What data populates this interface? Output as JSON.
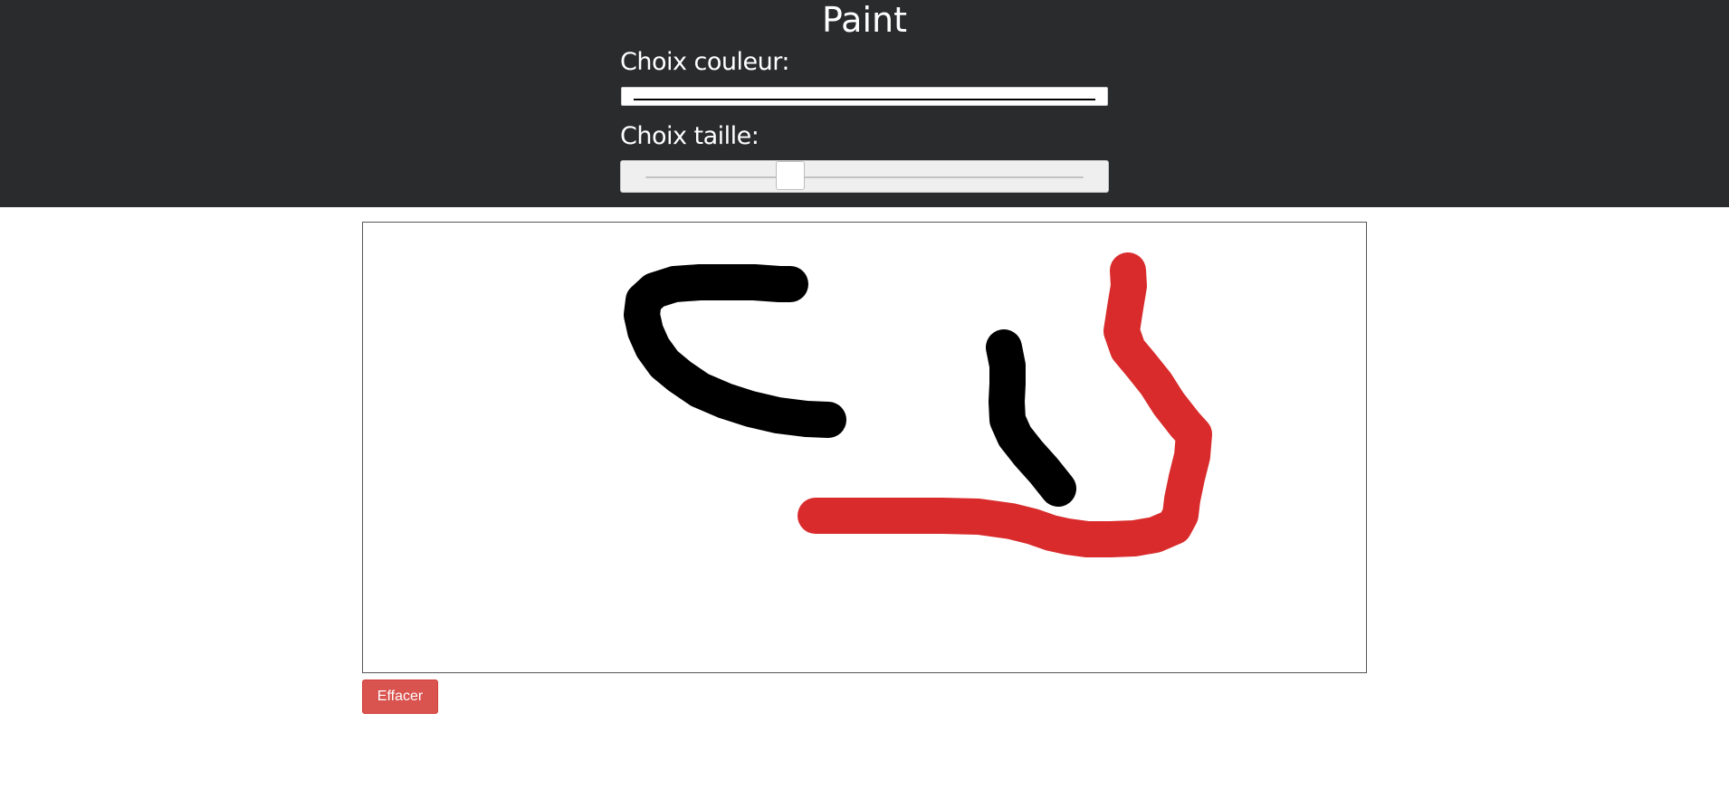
{
  "header": {
    "title": "Paint",
    "color_label": "Choix couleur:",
    "size_label": "Choix taille:"
  },
  "controls": {
    "color_value": "#000000",
    "size_slider_fraction": 0.33
  },
  "canvas": {
    "strokes": [
      {
        "color": "#000000",
        "kind": "brush-stroke"
      },
      {
        "color": "#000000",
        "kind": "brush-stroke"
      },
      {
        "color": "#d92b2b",
        "kind": "brush-stroke"
      }
    ]
  },
  "actions": {
    "clear_label": "Effacer"
  },
  "colors": {
    "header_bg": "#2a2b2d",
    "danger": "#d9534f",
    "stroke_black": "#000000",
    "stroke_red": "#d92b2b"
  }
}
